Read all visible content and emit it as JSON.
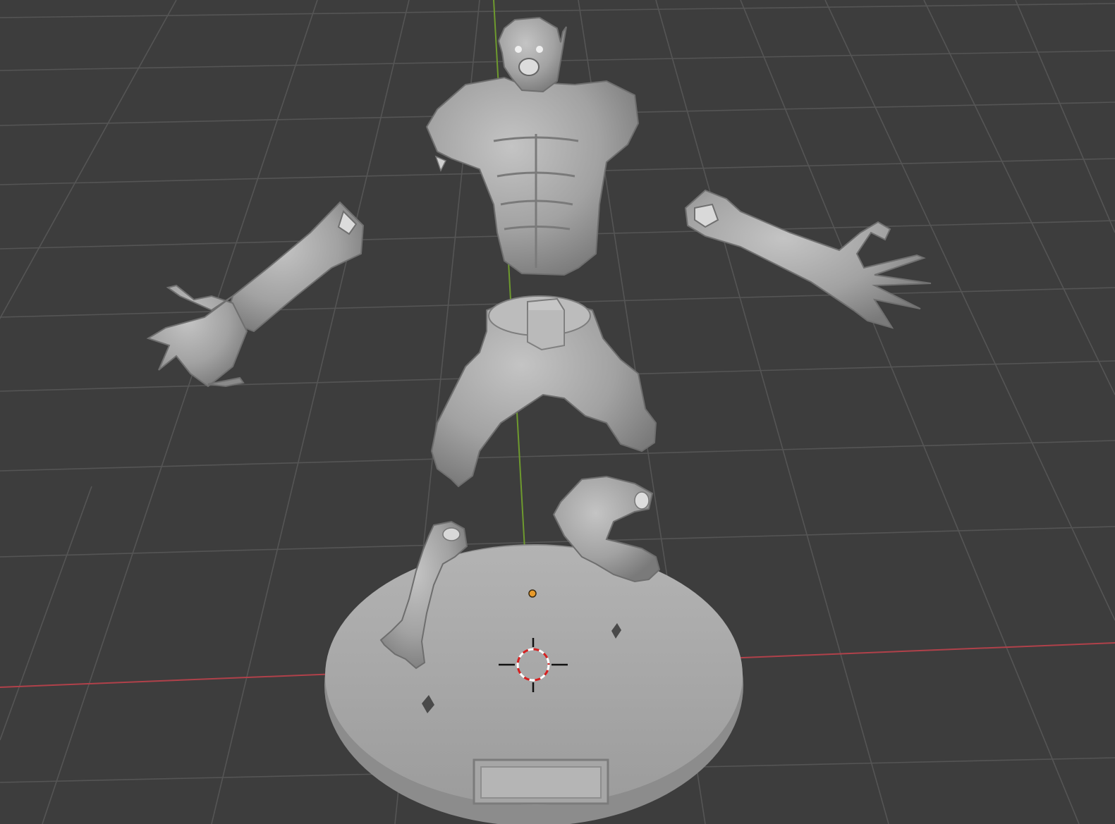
{
  "app": {
    "view": "3D Viewport"
  },
  "colors": {
    "background": "#3d3d3d",
    "grid": "#555555",
    "x_axis": "#b0414a",
    "y_axis": "#6e9a2e",
    "model": "#9a9a9a",
    "model_light": "#b9b9b9",
    "model_dark": "#6f6f6f",
    "origin": "#e89a2a",
    "cursor_red": "#d62020"
  },
  "scene": {
    "objects": [
      "torso-bust",
      "left-arm",
      "right-arm",
      "pelvis-legs",
      "left-leg",
      "right-leg",
      "display-base"
    ],
    "icons": [
      "3d-cursor-icon",
      "object-origin-icon"
    ]
  }
}
